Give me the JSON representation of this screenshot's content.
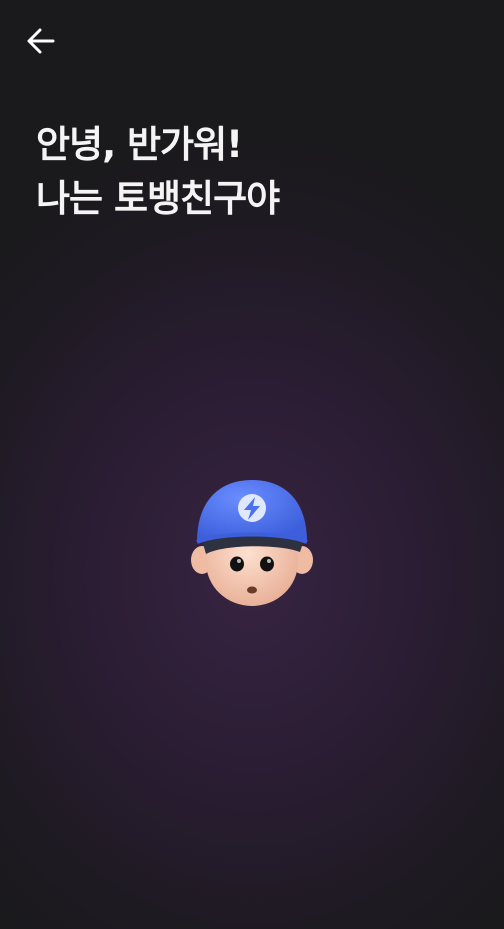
{
  "header": {
    "back_icon": "arrow-left-icon"
  },
  "greeting": {
    "line1": "안녕, 반가워!",
    "line2": "나는 토뱅친구야"
  },
  "character": {
    "icon": "bank-friend-character",
    "cap_color": "#4a72f0",
    "visor_color": "#2e3140",
    "face_color": "#f6c7b0"
  },
  "colors": {
    "background": "#1a191c",
    "glow": "#372442",
    "text": "#f4f4f4"
  }
}
